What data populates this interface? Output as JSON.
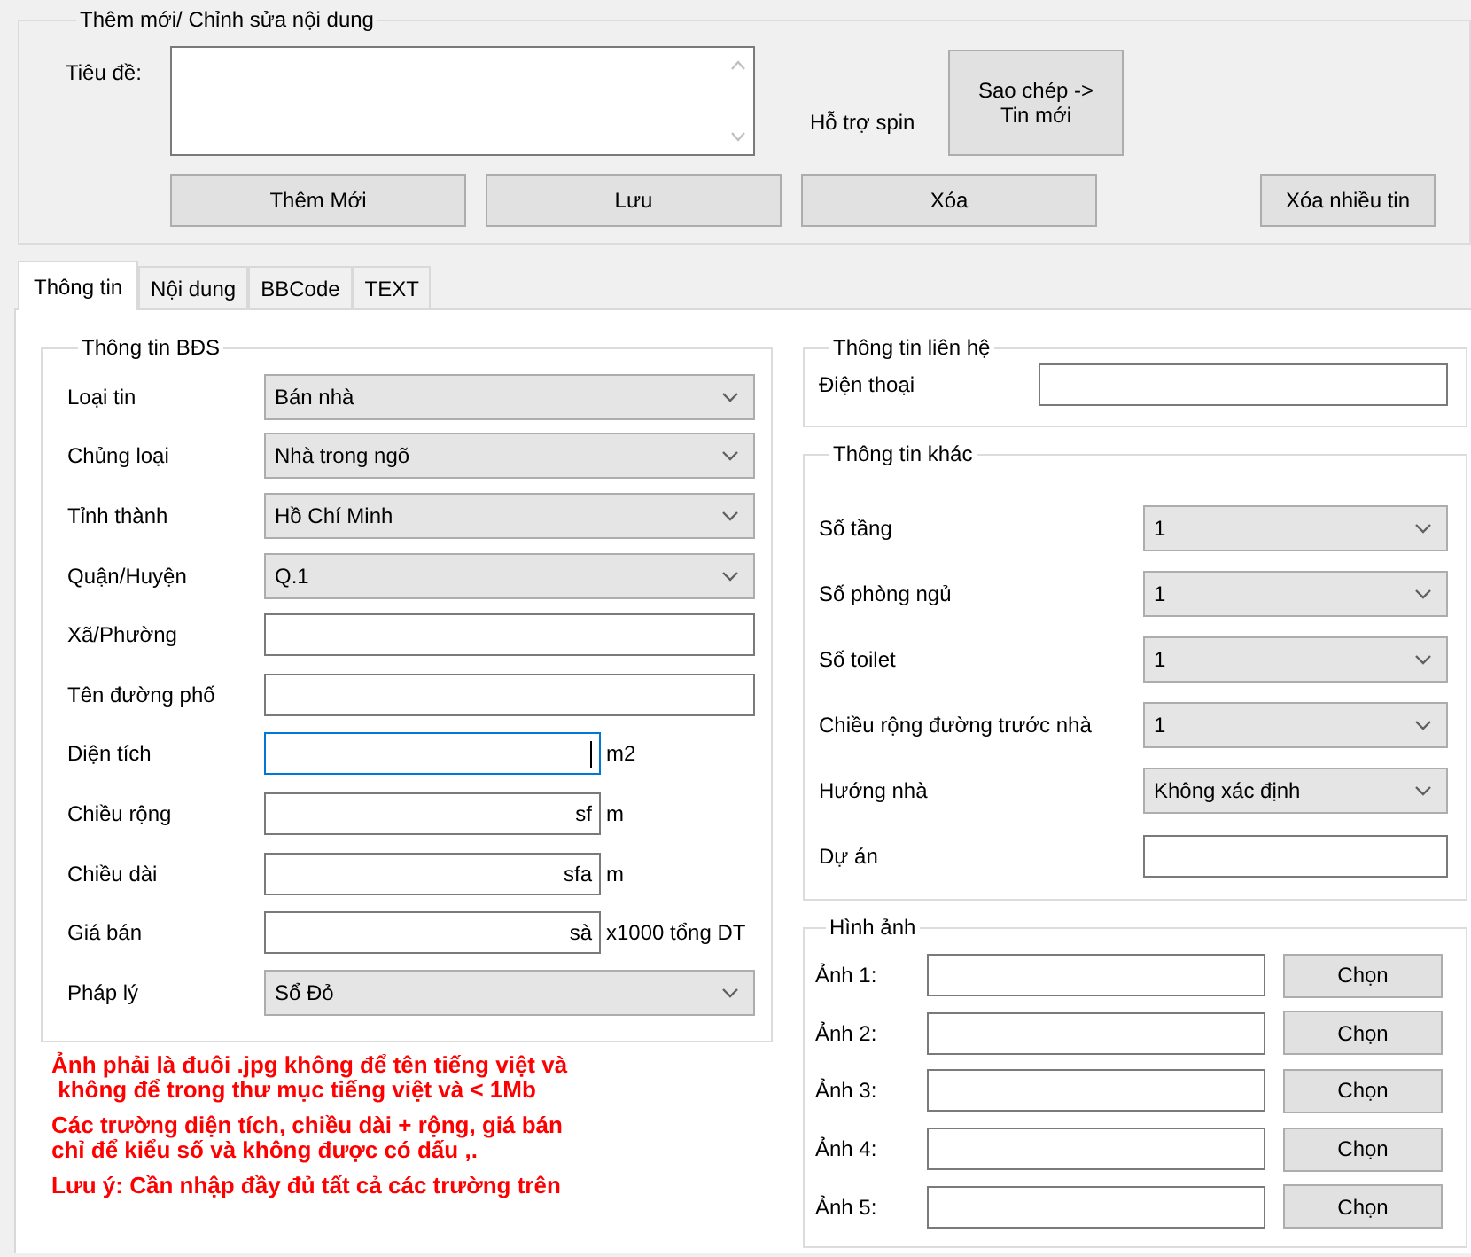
{
  "edit_group": {
    "title": "Thêm mới/ Chỉnh sửa nội dung",
    "title_label": "Tiêu đề:",
    "spin_label": "Hỗ trợ spin",
    "copy_button": "Sao chép -> Tin mới",
    "buttons": [
      "Thêm Mới",
      "Lưu",
      "Xóa"
    ],
    "delete_many_button": "Xóa nhiều tin"
  },
  "tabs": [
    {
      "label": "Thông tin",
      "selected": true
    },
    {
      "label": "Nội dung",
      "selected": false
    },
    {
      "label": "BBCode",
      "selected": false
    },
    {
      "label": "TEXT",
      "selected": false
    }
  ],
  "property_group": {
    "title": "Thông tin BĐS",
    "rows": [
      {
        "label": "Loại tin",
        "kind": "combo",
        "value": "Bán nhà"
      },
      {
        "label": "Chủng loại",
        "kind": "combo",
        "value": "Nhà trong ngõ"
      },
      {
        "label": "Tỉnh thành",
        "kind": "combo",
        "value": "Hồ Chí Minh"
      },
      {
        "label": "Quận/Huyện",
        "kind": "combo",
        "value": "Q.1"
      },
      {
        "label": "Xã/Phường",
        "kind": "text"
      },
      {
        "label": "Tên đường phố",
        "kind": "text"
      },
      {
        "label": "Diện tích",
        "kind": "number",
        "unit": "m2",
        "focused": true
      },
      {
        "label": "Chiều rộng",
        "kind": "number",
        "value": "sf",
        "unit": "m",
        "focused": false
      },
      {
        "label": "Chiều dài",
        "kind": "number",
        "value": "sfa",
        "unit": "m",
        "focused": false
      },
      {
        "label": "Giá bán",
        "kind": "number",
        "value": "sà",
        "unit": "x1000 tổng DT",
        "focused": false
      },
      {
        "label": "Pháp lý",
        "kind": "combo",
        "value": "Sổ Đỏ"
      }
    ]
  },
  "notes": [
    "Ảnh phải là đuôi .jpg không để tên tiếng việt và\n không để trong thư mục tiếng việt và < 1Mb",
    "Các trường diện tích, chiều dài + rộng, giá bán\nchỉ để kiểu số và không được có dấu ,.",
    "Lưu ý: Cần nhập đầy đủ tất cả các trường trên"
  ],
  "contact_group": {
    "title": "Thông tin liên hệ",
    "phone_label": "Điện thoại"
  },
  "other_group": {
    "title": "Thông tin khác",
    "rows": [
      {
        "label": "Số tầng",
        "kind": "combo",
        "value": "1"
      },
      {
        "label": "Số phòng ngủ",
        "kind": "combo",
        "value": "1"
      },
      {
        "label": "Số toilet",
        "kind": "combo",
        "value": "1"
      },
      {
        "label": "Chiều rộng đường trước nhà",
        "kind": "combo",
        "value": "1"
      },
      {
        "label": "Hướng nhà",
        "kind": "combo",
        "value": "Không xác định"
      },
      {
        "label": "Dự án",
        "kind": "text"
      }
    ]
  },
  "images_group": {
    "title": "Hình ảnh",
    "rows": [
      {
        "label": "Ảnh 1:",
        "button": "Chọn"
      },
      {
        "label": "Ảnh 2:",
        "button": "Chọn"
      },
      {
        "label": "Ảnh 3:",
        "button": "Chọn"
      },
      {
        "label": "Ảnh 4:",
        "button": "Chọn"
      },
      {
        "label": "Ảnh 5:",
        "button": "Chọn"
      }
    ]
  }
}
